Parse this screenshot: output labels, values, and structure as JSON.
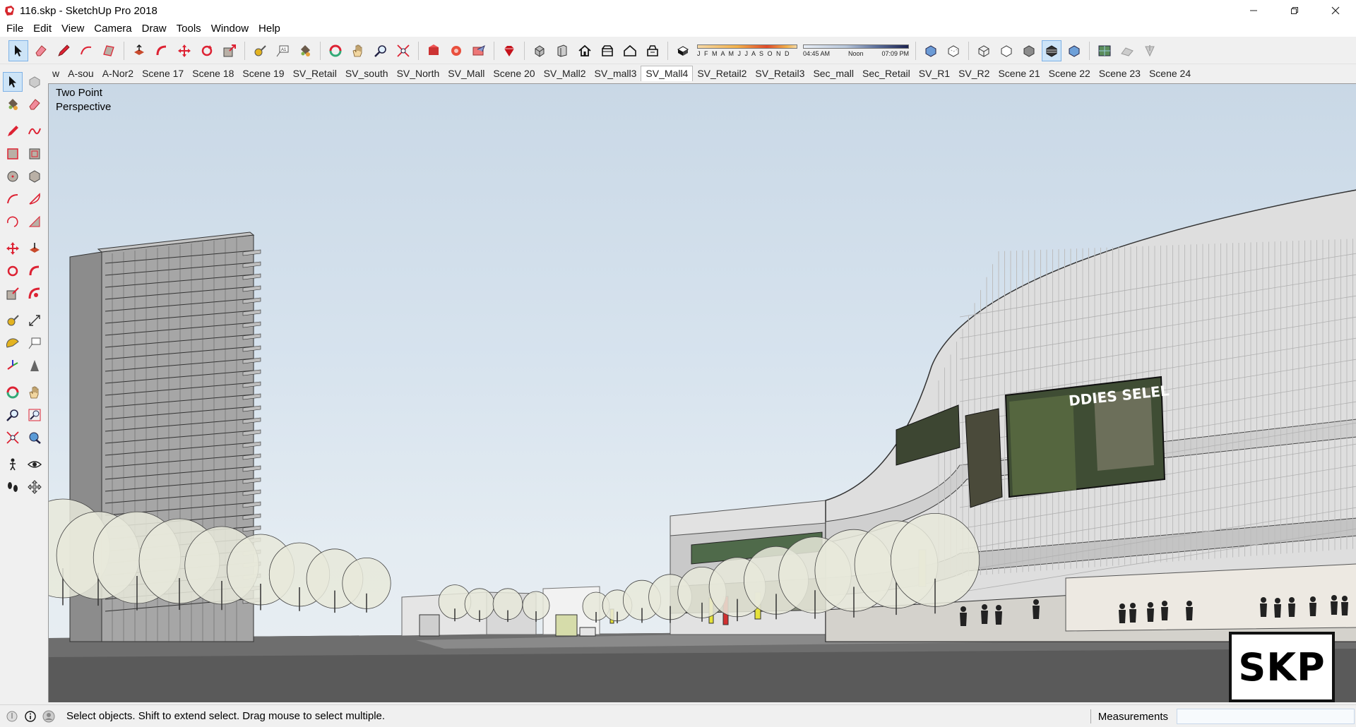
{
  "window": {
    "title": "116.skp - SketchUp Pro 2018"
  },
  "menu": [
    "File",
    "Edit",
    "View",
    "Camera",
    "Draw",
    "Tools",
    "Window",
    "Help"
  ],
  "toolbar": {
    "months": "J F M A M J J A S O N D",
    "time_start": "04:45 AM",
    "time_mid": "Noon",
    "time_end": "07:09 PM"
  },
  "scenes": {
    "tabs": [
      "w",
      "A-sou",
      "A-Nor2",
      "Scene 17",
      "Scene 18",
      "Scene 19",
      "SV_Retail",
      "SV_south",
      "SV_North",
      "SV_Mall",
      "Scene 20",
      "SV_Mall2",
      "SV_mall3",
      "SV_Mall4",
      "SV_Retail2",
      "SV_Retail3",
      "Sec_mall",
      "Sec_Retail",
      "SV_R1",
      "SV_R2",
      "Scene 21",
      "Scene 22",
      "Scene 23",
      "Scene 24"
    ],
    "active": "SV_Mall4"
  },
  "viewport": {
    "camera_line1": "Two Point",
    "camera_line2": "Perspective",
    "billboard_text": "DDIES SELEL",
    "logo_text": "SKP"
  },
  "status": {
    "message": "Select objects. Shift to extend select. Drag mouse to select multiple.",
    "measurements_label": "Measurements",
    "measurements_value": ""
  },
  "colors": {
    "accent": "#cde4f7",
    "sky_top": "#c9d8e6",
    "ground": "#5c5c5c"
  }
}
